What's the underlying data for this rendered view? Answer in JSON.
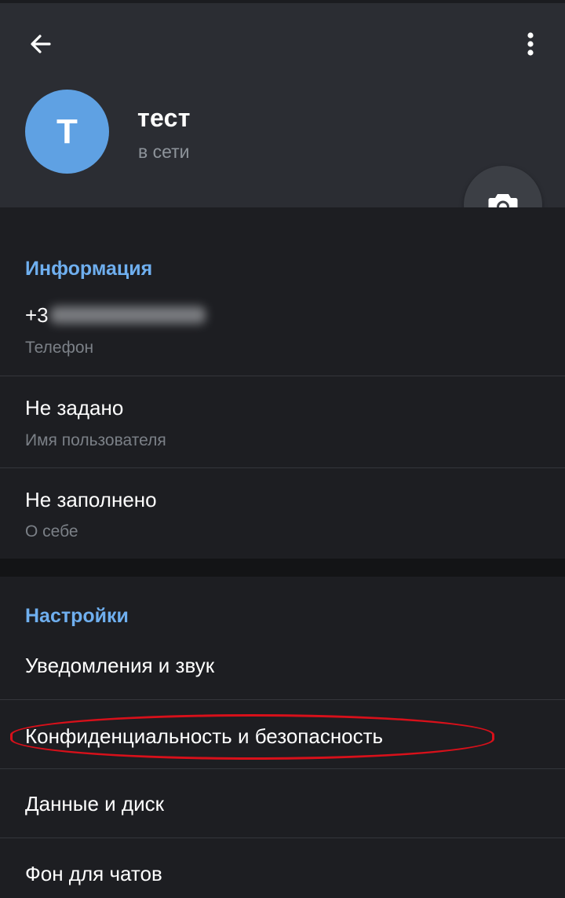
{
  "header": {
    "avatar_letter": "T",
    "name": "тест",
    "status": "в сети"
  },
  "info_section": {
    "title": "Информация",
    "phone": {
      "value": "+3",
      "label": "Телефон"
    },
    "username": {
      "value": "Не задано",
      "label": "Имя пользователя"
    },
    "bio": {
      "value": "Не заполнено",
      "label": "О себе"
    }
  },
  "settings_section": {
    "title": "Настройки",
    "items": [
      {
        "label": "Уведомления и звук"
      },
      {
        "label": "Конфиденциальность и безопасность"
      },
      {
        "label": "Данные и диск"
      },
      {
        "label": "Фон для чатов"
      }
    ]
  },
  "colors": {
    "header_bg": "#2b2d33",
    "body_bg": "#1d1e22",
    "accent": "#6fafef",
    "avatar": "#5fa1e3",
    "highlight": "#d8101a"
  },
  "icons": [
    "back-arrow-icon",
    "more-vertical-icon",
    "camera-icon"
  ]
}
